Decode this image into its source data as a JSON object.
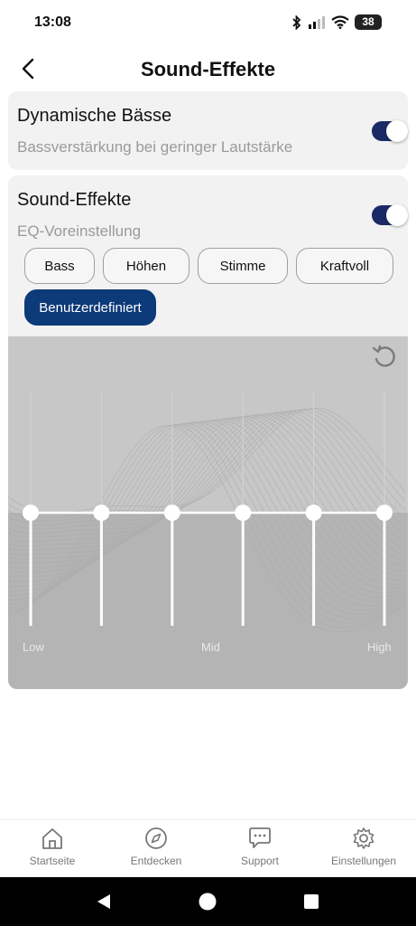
{
  "status_bar": {
    "time": "13:08",
    "battery": "38"
  },
  "header": {
    "title": "Sound-Effekte"
  },
  "dynamic_bass": {
    "title": "Dynamische Bässe",
    "subtitle": "Bassverstärkung bei geringer Lautstärke",
    "enabled": true
  },
  "sound_effects": {
    "title": "Sound-Effekte",
    "subtitle": "EQ-Voreinstellung",
    "enabled": true,
    "presets": [
      "Bass",
      "Höhen",
      "Stimme",
      "Kraftvoll",
      "Benutzerdefiniert"
    ],
    "selected_preset": "Benutzerdefiniert"
  },
  "equalizer": {
    "band_count": 6,
    "band_levels": [
      0,
      0,
      0,
      0,
      0,
      0
    ],
    "labels": {
      "low": "Low",
      "mid": "Mid",
      "high": "High"
    }
  },
  "bottom_nav": {
    "items": [
      {
        "label": "Startseite",
        "icon": "home-icon"
      },
      {
        "label": "Entdecken",
        "icon": "compass-icon"
      },
      {
        "label": "Support",
        "icon": "chat-bubble-icon"
      },
      {
        "label": "Einstellungen",
        "icon": "gear-icon"
      }
    ]
  },
  "colors": {
    "accent": "#0d3a78",
    "toggle_on": "#1b2a66",
    "card_bg": "#f2f2f2",
    "eq_bg": "#bdbdbd"
  }
}
